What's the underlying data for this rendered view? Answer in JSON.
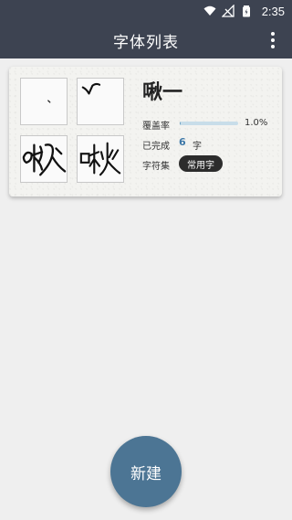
{
  "status_bar": {
    "time": "2:35",
    "icons": [
      "wifi-icon",
      "signal-icon",
      "battery-icon"
    ]
  },
  "app_bar": {
    "title": "字体列表",
    "menu_icon": "more-vert-icon"
  },
  "font_card": {
    "name": "啾一",
    "coverage_label": "覆盖率",
    "coverage_value": "1.0%",
    "coverage_fraction": 0.01,
    "completed_label": "已完成",
    "completed_count": "6",
    "completed_unit": "字",
    "charset_label": "字符集",
    "charset_value": "常用字",
    "previews": [
      "glyph-preview-1",
      "glyph-preview-2",
      "glyph-preview-3",
      "glyph-preview-4"
    ]
  },
  "fab": {
    "label": "新建"
  },
  "colors": {
    "app_bar": "#3d4351",
    "background": "#efefef",
    "accent": "#4c7594",
    "progress": "#6da3c4",
    "count": "#3d78a8"
  }
}
